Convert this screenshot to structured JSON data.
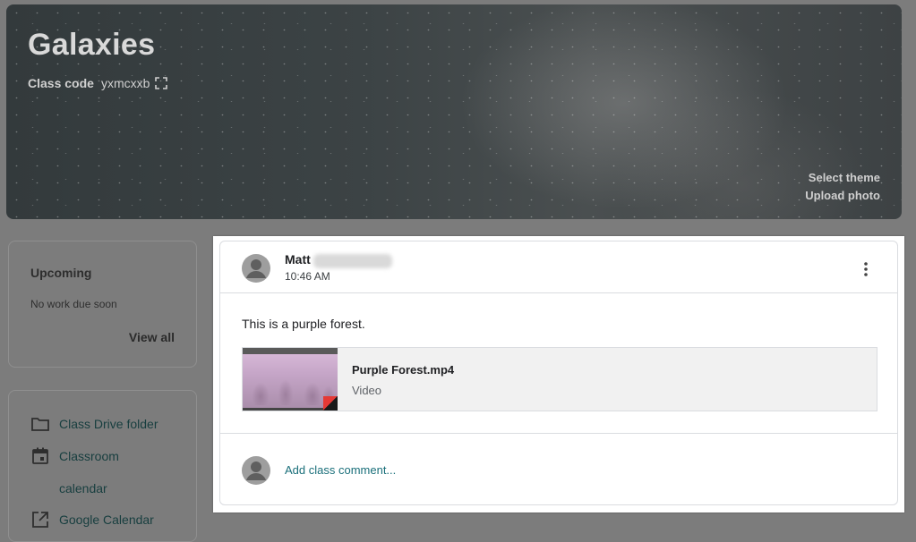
{
  "banner": {
    "title": "Galaxies",
    "class_code_label": "Class code",
    "class_code": "yxmcxxb",
    "select_theme": "Select theme",
    "upload_photo": "Upload photo"
  },
  "upcoming": {
    "title": "Upcoming",
    "empty_text": "No work due soon",
    "view_all": "View all"
  },
  "links": {
    "items": [
      {
        "label": "Class Drive folder",
        "icon": "folder-icon"
      },
      {
        "label": "Classroom calendar",
        "icon": "calendar-icon"
      },
      {
        "label": "Google Calendar",
        "icon": "external-link-icon"
      }
    ]
  },
  "post": {
    "author": "Matt",
    "time": "10:46 AM",
    "text": "This is a purple forest.",
    "attachment": {
      "name": "Purple Forest.mp4",
      "type": "Video"
    },
    "comment_placeholder": "Add class comment..."
  },
  "colors": {
    "accent": "#1a6f7a",
    "overlay": "#7c7c7c"
  }
}
